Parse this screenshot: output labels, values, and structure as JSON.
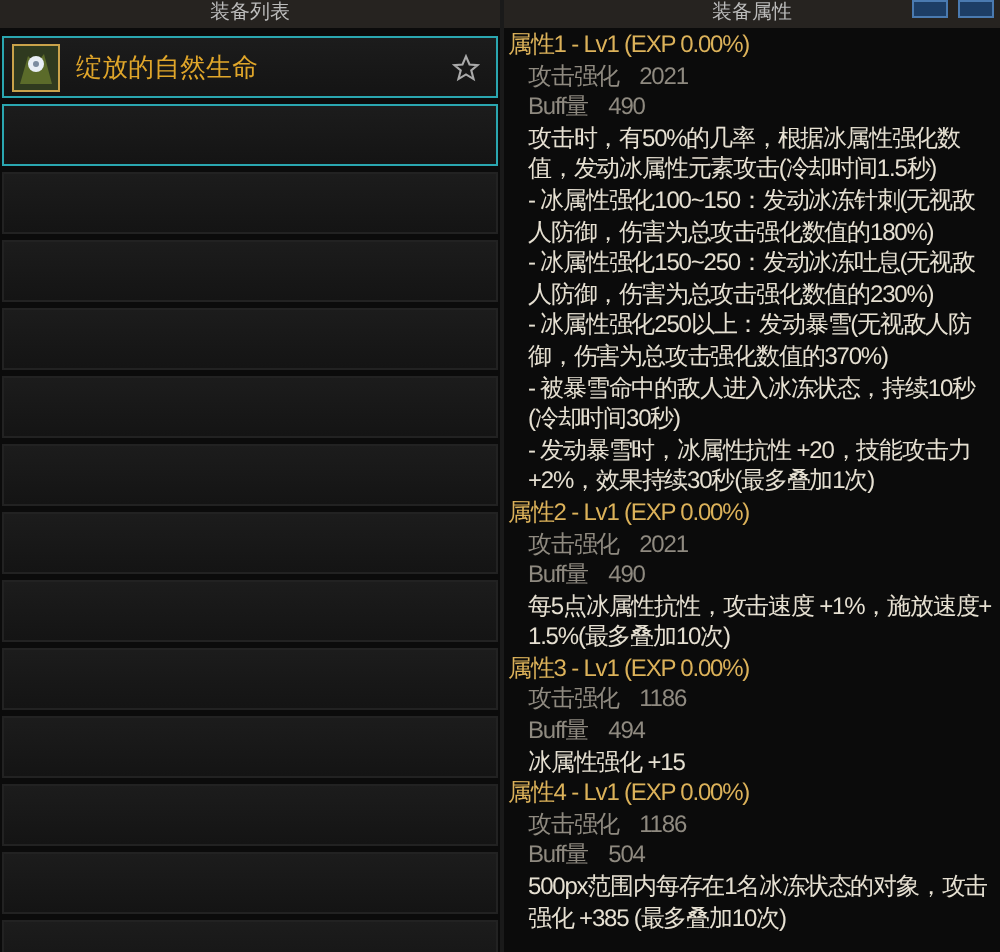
{
  "equipment_list": {
    "header": "装备列表",
    "slots": [
      {
        "kind": "item",
        "name": "绽放的自然生命",
        "outlined": true,
        "favorite": false
      },
      {
        "kind": "empty",
        "outlined": true
      },
      {
        "kind": "empty",
        "outlined": false
      },
      {
        "kind": "empty",
        "outlined": false
      },
      {
        "kind": "empty",
        "outlined": false
      },
      {
        "kind": "empty",
        "outlined": false
      },
      {
        "kind": "empty",
        "outlined": false
      },
      {
        "kind": "empty",
        "outlined": false
      },
      {
        "kind": "empty",
        "outlined": false
      },
      {
        "kind": "empty",
        "outlined": false
      },
      {
        "kind": "empty",
        "outlined": false
      },
      {
        "kind": "empty",
        "outlined": false
      },
      {
        "kind": "empty",
        "outlined": false
      },
      {
        "kind": "empty",
        "outlined": false
      }
    ]
  },
  "equipment_attributes": {
    "header": "装备属性",
    "attributes": [
      {
        "title": "属性1 - Lv1 (EXP 0.00%)",
        "stats": [
          {
            "label": "攻击强化",
            "value": "2021"
          },
          {
            "label": "Buff量",
            "value": "490"
          }
        ],
        "effects": [
          "攻击时，有50%的几率，根据冰属性强化数值，发动冰属性元素攻击(冷却时间1.5秒)",
          "- 冰属性强化100~150：发动冰冻针刺(无视敌人防御，伤害为总攻击强化数值的180%)",
          "- 冰属性强化150~250：发动冰冻吐息(无视敌人防御，伤害为总攻击强化数值的230%)",
          "- 冰属性强化250以上：发动暴雪(无视敌人防御，伤害为总攻击强化数值的370%)",
          "- 被暴雪命中的敌人进入冰冻状态，持续10秒(冷却时间30秒)",
          "- 发动暴雪时，冰属性抗性 +20，技能攻击力 +2%，效果持续30秒(最多叠加1次)"
        ]
      },
      {
        "title": "属性2 - Lv1 (EXP 0.00%)",
        "stats": [
          {
            "label": "攻击强化",
            "value": "2021"
          },
          {
            "label": "Buff量",
            "value": "490"
          }
        ],
        "effects": [
          "每5点冰属性抗性，攻击速度 +1%，施放速度+ 1.5%(最多叠加10次)"
        ]
      },
      {
        "title": "属性3 - Lv1 (EXP 0.00%)",
        "stats": [
          {
            "label": "攻击强化",
            "value": "1186"
          },
          {
            "label": "Buff量",
            "value": "494"
          }
        ],
        "effects": [
          "冰属性强化 +15"
        ]
      },
      {
        "title": "属性4 - Lv1 (EXP 0.00%)",
        "stats": [
          {
            "label": "攻击强化",
            "value": "1186"
          },
          {
            "label": "Buff量",
            "value": "504"
          }
        ],
        "effects": [
          "500px范围内每存在1名冰冻状态的对象，攻击强化 +385 (最多叠加10次)"
        ]
      }
    ]
  }
}
